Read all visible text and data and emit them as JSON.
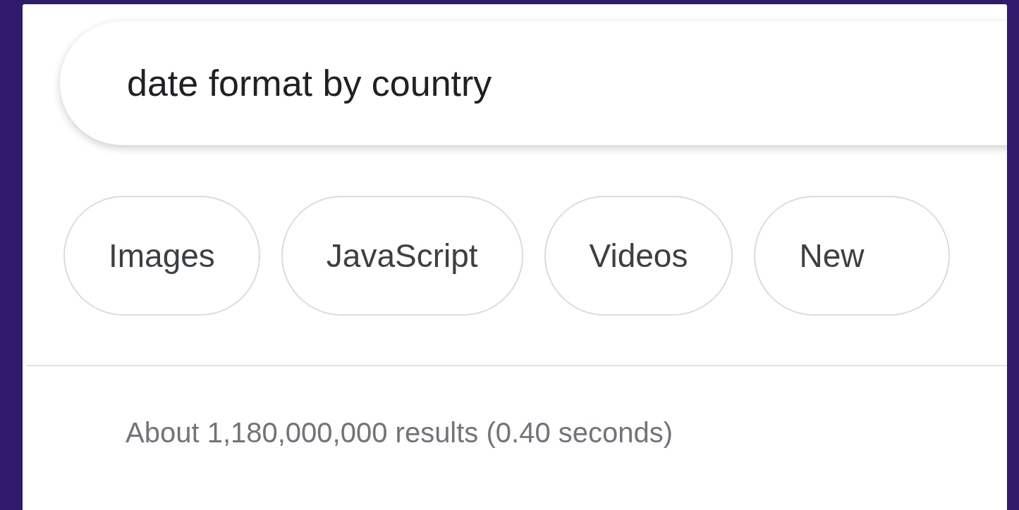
{
  "search": {
    "value": "date format by country"
  },
  "chips": [
    {
      "label": "Images"
    },
    {
      "label": "JavaScript"
    },
    {
      "label": "Videos"
    },
    {
      "label": "New"
    }
  ],
  "results_stats": "About 1,180,000,000 results (0.40 seconds)"
}
